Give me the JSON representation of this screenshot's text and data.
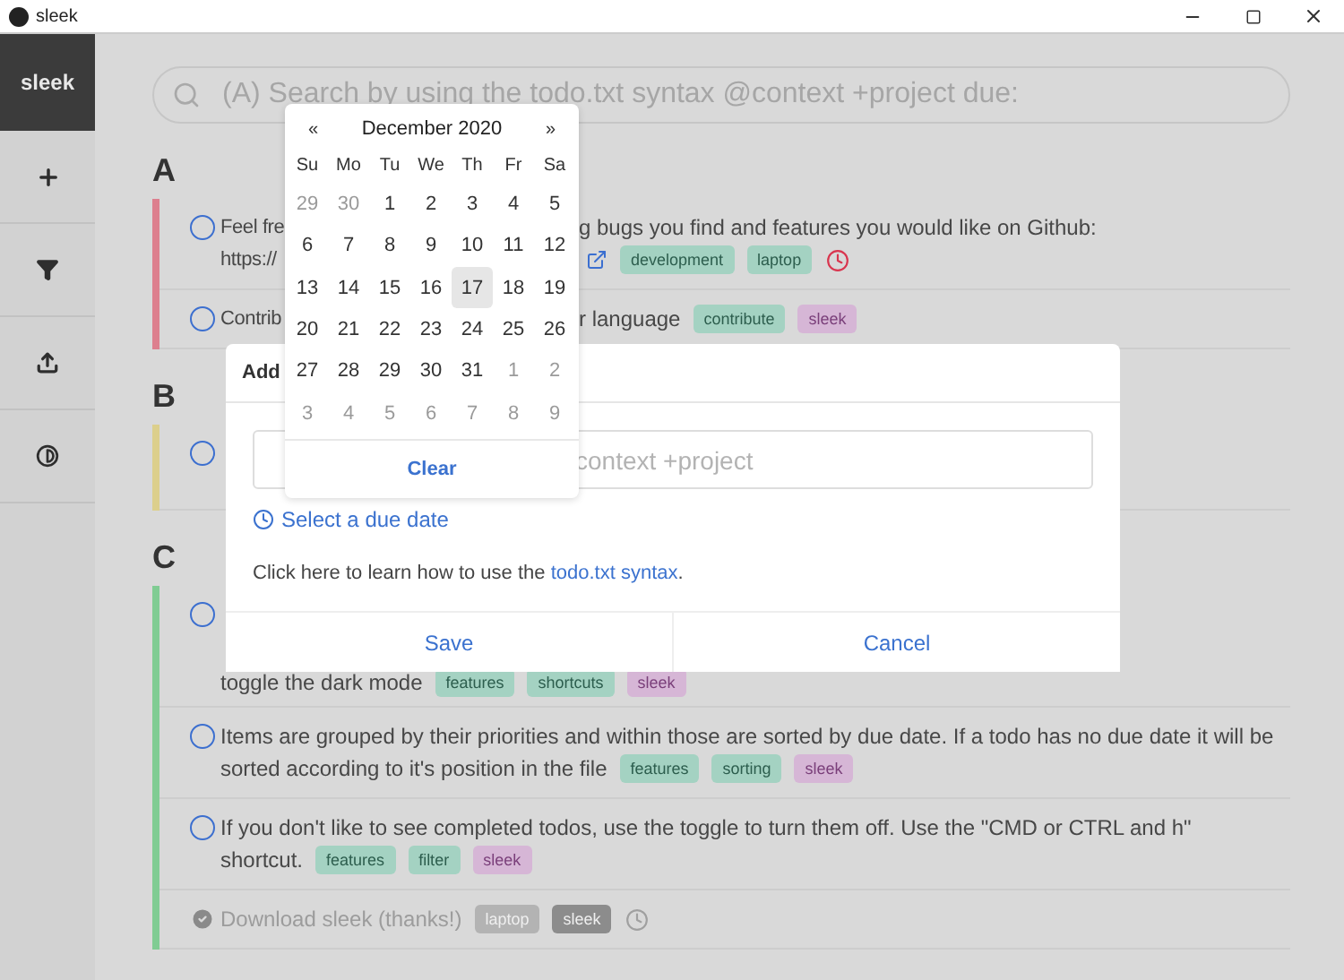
{
  "window": {
    "title": "sleek"
  },
  "sidebar": {
    "title": "sleek"
  },
  "search": {
    "placeholder": "(A) Search by using the todo.txt syntax @context +project due:"
  },
  "groups": [
    {
      "label": "A",
      "color": "#dd7f8e",
      "items": [
        {
          "kind": "task",
          "done": false,
          "due": true,
          "lines": [
            {
              "left": "Feel fre",
              "right": "g bugs you find and features you would like on Github:"
            },
            {
              "left": "https://",
              "link": true
            }
          ],
          "tags": [
            {
              "label": "development",
              "kind": "context"
            },
            {
              "label": "laptop",
              "kind": "context"
            }
          ]
        },
        {
          "kind": "task",
          "done": false,
          "due": false,
          "lines": [
            {
              "left": "Contrib",
              "right": "r language"
            }
          ],
          "tags": [
            {
              "label": "contribute",
              "kind": "context"
            },
            {
              "label": "sleek",
              "kind": "project"
            }
          ]
        }
      ]
    },
    {
      "label": "B",
      "color": "#dccf8c",
      "items": [
        {
          "kind": "covered",
          "done": false,
          "due": false
        }
      ]
    },
    {
      "label": "C",
      "color": "#80cc93",
      "items": [
        {
          "kind": "covered",
          "done": false,
          "due": false,
          "lines": [
            {
              "left": "toggle the dark mode"
            }
          ],
          "tags": [
            {
              "label": "features",
              "kind": "context"
            },
            {
              "label": "shortcuts",
              "kind": "context"
            },
            {
              "label": "sleek",
              "kind": "project"
            }
          ]
        },
        {
          "kind": "task",
          "done": false,
          "due": false,
          "lines": [
            {
              "left": "Items are grouped by their priorities and within those are sorted by due date. If a todo has no due date it will be"
            },
            {
              "left": "sorted according to it's position in the file"
            }
          ],
          "tags": [
            {
              "label": "features",
              "kind": "context"
            },
            {
              "label": "sorting",
              "kind": "context"
            },
            {
              "label": "sleek",
              "kind": "project"
            }
          ]
        },
        {
          "kind": "task",
          "done": false,
          "due": false,
          "lines": [
            {
              "left": "If you don't like to see completed todos, use the toggle to turn them off. Use the \"CMD or CTRL and h\""
            },
            {
              "left": "shortcut."
            }
          ],
          "tags": [
            {
              "label": "features",
              "kind": "context"
            },
            {
              "label": "filter",
              "kind": "context"
            },
            {
              "label": "sleek",
              "kind": "project"
            }
          ]
        },
        {
          "kind": "task",
          "done": true,
          "due": true,
          "lines": [
            {
              "left": "Download sleek (thanks!)"
            }
          ],
          "tags": [
            {
              "label": "laptop",
              "kind": "context"
            },
            {
              "label": "sleek",
              "kind": "project"
            }
          ]
        }
      ]
    }
  ],
  "modal": {
    "title": "Add",
    "input_placeholder": "context +project",
    "due_link": "Select a due date",
    "help_text": "Click here to learn how to use the ",
    "help_link": "todo.txt syntax",
    "help_end": ".",
    "buttons": [
      "Save",
      "Cancel"
    ]
  },
  "calendar": {
    "prev": "«",
    "title": "December 2020",
    "next": "»",
    "weekdays": [
      "Su",
      "Mo",
      "Tu",
      "We",
      "Th",
      "Fr",
      "Sa"
    ],
    "weeks": [
      [
        {
          "label": "29",
          "muted": true,
          "selected": false
        },
        {
          "label": "30",
          "muted": true,
          "selected": false
        },
        {
          "label": "1",
          "muted": false,
          "selected": false
        },
        {
          "label": "2",
          "muted": false,
          "selected": false
        },
        {
          "label": "3",
          "muted": false,
          "selected": false
        },
        {
          "label": "4",
          "muted": false,
          "selected": false
        },
        {
          "label": "5",
          "muted": false,
          "selected": false
        }
      ],
      [
        {
          "label": "6",
          "muted": false,
          "selected": false
        },
        {
          "label": "7",
          "muted": false,
          "selected": false
        },
        {
          "label": "8",
          "muted": false,
          "selected": false
        },
        {
          "label": "9",
          "muted": false,
          "selected": false
        },
        {
          "label": "10",
          "muted": false,
          "selected": false
        },
        {
          "label": "11",
          "muted": false,
          "selected": false
        },
        {
          "label": "12",
          "muted": false,
          "selected": false
        }
      ],
      [
        {
          "label": "13",
          "muted": false,
          "selected": false
        },
        {
          "label": "14",
          "muted": false,
          "selected": false
        },
        {
          "label": "15",
          "muted": false,
          "selected": false
        },
        {
          "label": "16",
          "muted": false,
          "selected": false
        },
        {
          "label": "17",
          "muted": false,
          "selected": true
        },
        {
          "label": "18",
          "muted": false,
          "selected": false
        },
        {
          "label": "19",
          "muted": false,
          "selected": false
        }
      ],
      [
        {
          "label": "20",
          "muted": false,
          "selected": false
        },
        {
          "label": "21",
          "muted": false,
          "selected": false
        },
        {
          "label": "22",
          "muted": false,
          "selected": false
        },
        {
          "label": "23",
          "muted": false,
          "selected": false
        },
        {
          "label": "24",
          "muted": false,
          "selected": false
        },
        {
          "label": "25",
          "muted": false,
          "selected": false
        },
        {
          "label": "26",
          "muted": false,
          "selected": false
        }
      ],
      [
        {
          "label": "27",
          "muted": false,
          "selected": false
        },
        {
          "label": "28",
          "muted": false,
          "selected": false
        },
        {
          "label": "29",
          "muted": false,
          "selected": false
        },
        {
          "label": "30",
          "muted": false,
          "selected": false
        },
        {
          "label": "31",
          "muted": false,
          "selected": false
        },
        {
          "label": "1",
          "muted": true,
          "selected": false
        },
        {
          "label": "2",
          "muted": true,
          "selected": false
        }
      ],
      [
        {
          "label": "3",
          "muted": true,
          "selected": false
        },
        {
          "label": "4",
          "muted": true,
          "selected": false
        },
        {
          "label": "5",
          "muted": true,
          "selected": false
        },
        {
          "label": "6",
          "muted": true,
          "selected": false
        },
        {
          "label": "7",
          "muted": true,
          "selected": false
        },
        {
          "label": "8",
          "muted": true,
          "selected": false
        },
        {
          "label": "9",
          "muted": true,
          "selected": false
        }
      ]
    ],
    "clear": "Clear"
  }
}
